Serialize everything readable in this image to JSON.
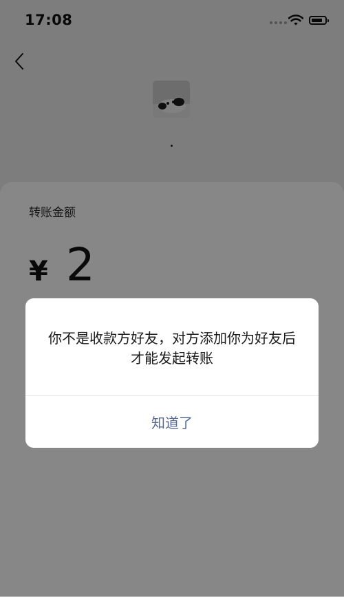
{
  "status_bar": {
    "time": "17:08"
  },
  "transfer": {
    "label": "转账金额",
    "currency": "¥",
    "amount": "2"
  },
  "dialog": {
    "message": "你不是收款方好友，对方添加你为好友后才能发起转账",
    "button": "知道了"
  },
  "colors": {
    "page_bg": "#ededed",
    "card_bg": "#ffffff",
    "dialog_button": "#576b95",
    "overlay": "rgba(0,0,0,0.47)"
  },
  "icons": [
    "wifi-icon",
    "battery-icon",
    "signal-dots-icon",
    "back-chevron-icon"
  ]
}
